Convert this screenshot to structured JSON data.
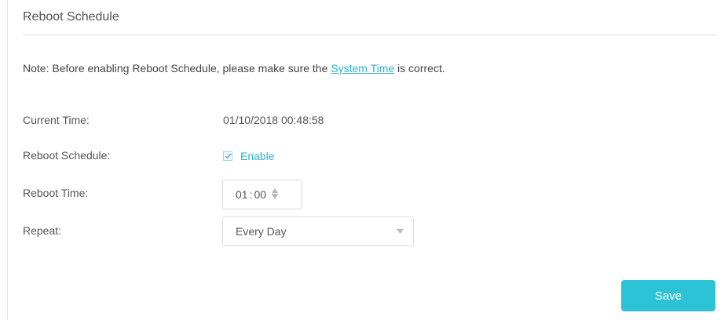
{
  "section": {
    "title": "Reboot Schedule"
  },
  "note": {
    "prefix": "Note: Before enabling Reboot Schedule, please make sure the ",
    "link_text": "System Time",
    "suffix": " is correct."
  },
  "fields": {
    "current_time": {
      "label": "Current Time:",
      "value": "01/10/2018 00:48:58"
    },
    "reboot_schedule": {
      "label": "Reboot Schedule:",
      "checkbox_label": "Enable",
      "checked": true
    },
    "reboot_time": {
      "label": "Reboot Time:",
      "hour": "01",
      "separator": ":",
      "minute": "00"
    },
    "repeat": {
      "label": "Repeat:",
      "selected": "Every Day"
    }
  },
  "actions": {
    "save_label": "Save"
  },
  "icons": {
    "checkbox": "check-icon",
    "spinner": "up-down-spinner-icon",
    "dropdown": "caret-down-icon"
  },
  "colors": {
    "accent": "#2bb2d6",
    "button": "#2cc3d6",
    "border": "#dcdcdc"
  }
}
